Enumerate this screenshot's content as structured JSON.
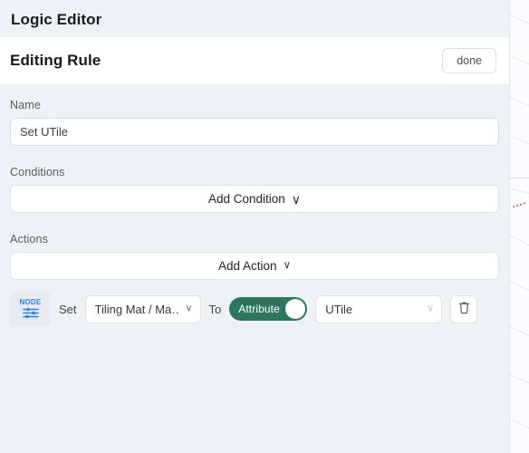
{
  "window": {
    "title": "Logic Editor"
  },
  "header": {
    "title": "Editing Rule",
    "done_label": "done"
  },
  "form": {
    "name_label": "Name",
    "name_value": "Set UTile",
    "name_placeholder": "Name"
  },
  "conditions": {
    "label": "Conditions",
    "add_label": "Add Condition",
    "add_chevron": "∨"
  },
  "actions": {
    "label": "Actions",
    "add_label": "Add Action",
    "add_chevron": "∨",
    "rows": [
      {
        "node_badge": "NODE",
        "node_icon": "sliders-icon",
        "set_word": "Set",
        "target_value": "Tiling Mat / Ma…",
        "target_chevron": "∨",
        "to_word": "To",
        "toggle_label": "Attribute",
        "toggle_on": true,
        "value_select": "UTile",
        "value_chevron": "∨",
        "delete_icon": "trash-icon"
      }
    ]
  },
  "colors": {
    "page_background": "#eef2f5",
    "surface": "#ffffff",
    "accent_green": "#2e7560",
    "node_blue": "#2f7df0",
    "border": "#dfe3e8",
    "text_primary": "#22262b",
    "text_muted": "#545b63"
  }
}
